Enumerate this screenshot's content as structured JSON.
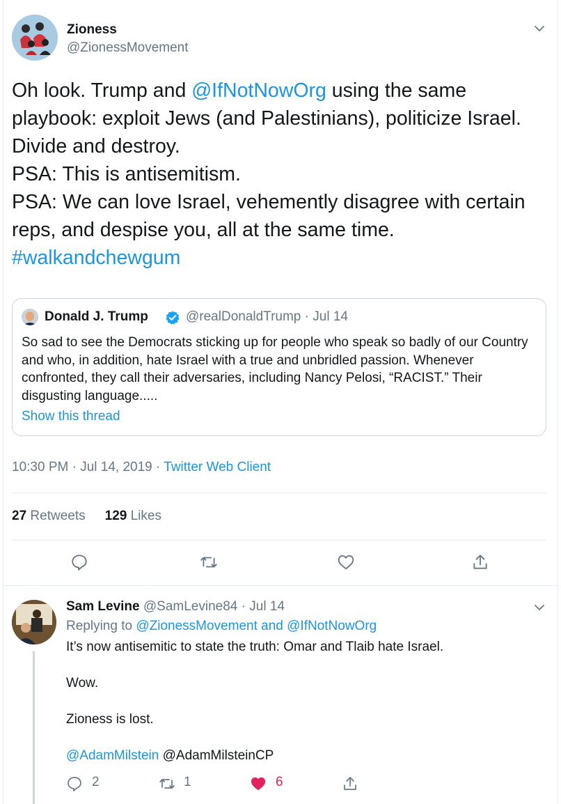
{
  "tweet": {
    "author_name": "Zioness",
    "author_handle": "@ZionessMovement",
    "text_part1": "Oh look. Trump and ",
    "mention": "@IfNotNowOrg",
    "text_part2": " using the same playbook: exploit Jews (and Palestinians), politicize Israel. Divide and destroy.\nPSA: This is antisemitism.\nPSA: We can love Israel, vehemently disagree with certain reps, and despise you, all at the same time.\n",
    "hashtag": "#walkandchewgum",
    "timestamp": "10:30 PM · Jul 14, 2019 · ",
    "client": "Twitter Web Client",
    "retweets_count": "27",
    "retweets_label": "Retweets",
    "likes_count": "129",
    "likes_label": "Likes"
  },
  "quoted": {
    "author_name": "Donald J. Trump",
    "author_handle": "@realDonaldTrump · Jul 14",
    "text": "So sad to see the Democrats sticking up for people who speak so badly of our Country and who, in addition, hate Israel with a true and unbridled passion. Whenever confronted, they call their adversaries, including Nancy Pelosi, “RACIST.” Their disgusting language.....",
    "show_thread": "Show this thread"
  },
  "reply": {
    "author_name": "Sam Levine",
    "author_meta": "@SamLevine84 · Jul 14",
    "replying_prefix": "Replying to ",
    "replying_to_1": "@ZionessMovement",
    "replying_and": " and ",
    "replying_to_2": "@IfNotNowOrg",
    "line1": "It’s now antisemitic to state the truth: Omar and Tlaib hate Israel.",
    "line2": "Wow.",
    "line3": "Zioness is lost.",
    "mention_link": "@AdamMilstein",
    "mention_text": " @AdamMilsteinCP",
    "reply_count": "2",
    "retweet_count": "1",
    "like_count": "6"
  },
  "icons": {
    "reply": "reply-icon",
    "retweet": "retweet-icon",
    "like": "heart-icon",
    "share": "share-icon",
    "verified": "verified-badge-icon",
    "caret": "chevron-down-icon"
  },
  "colors": {
    "link": "#1b95e0",
    "like_active": "#e0245e",
    "muted": "#657786"
  }
}
